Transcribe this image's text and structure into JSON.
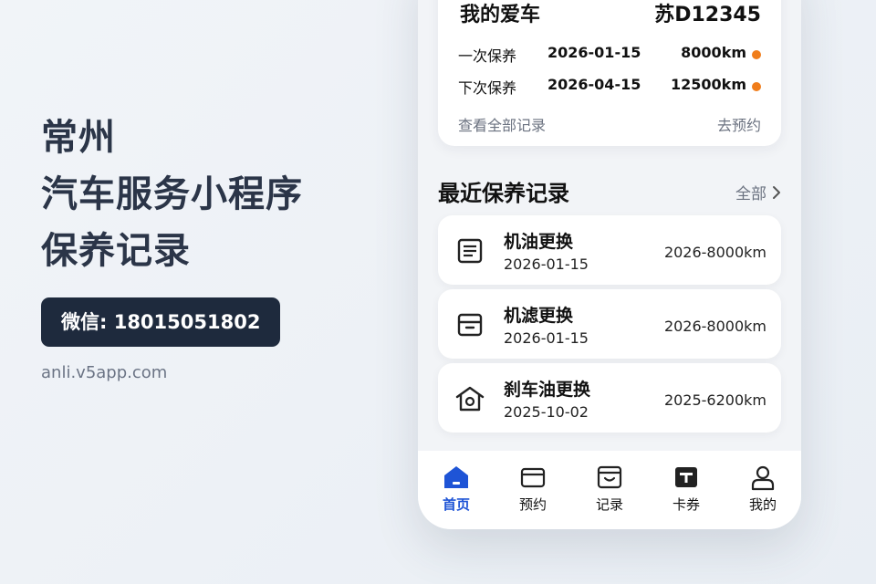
{
  "left": {
    "lines": [
      "常州",
      "汽车服务小程序",
      "保养记录"
    ],
    "wechat": "微信: 18015051802",
    "site": "anli.v5app.com"
  },
  "car": {
    "title": "我的爱车",
    "plate": "苏D12345",
    "rows": [
      {
        "label": "一次保养",
        "date": "2026-01-15",
        "km": "8000km"
      },
      {
        "label": "下次保养",
        "date": "2026-04-15",
        "km": "12500km"
      }
    ],
    "view_all": "查看全部记录",
    "book": "去预约"
  },
  "section": {
    "title": "最近保养记录",
    "all": "全部"
  },
  "records": [
    {
      "name": "机油更换",
      "date": "2026-01-15",
      "mileage": "2026-8000km",
      "icon": "document-icon"
    },
    {
      "name": "机滤更换",
      "date": "2026-01-15",
      "mileage": "2026-8000km",
      "icon": "filter-box-icon"
    },
    {
      "name": "刹车油更换",
      "date": "2025-10-02",
      "mileage": "2025-6200km",
      "icon": "garage-icon"
    }
  ],
  "tabs": [
    {
      "label": "首页",
      "icon": "home-icon"
    },
    {
      "label": "预约",
      "icon": "card-icon"
    },
    {
      "label": "记录",
      "icon": "records-box-icon"
    },
    {
      "label": "卡券",
      "icon": "coupon-icon"
    },
    {
      "label": "我的",
      "icon": "user-icon"
    }
  ],
  "colors": {
    "accent": "#1e54d6",
    "dot": "#f07d1a",
    "dark": "#1e2a3d",
    "headline": "#2b3548"
  }
}
